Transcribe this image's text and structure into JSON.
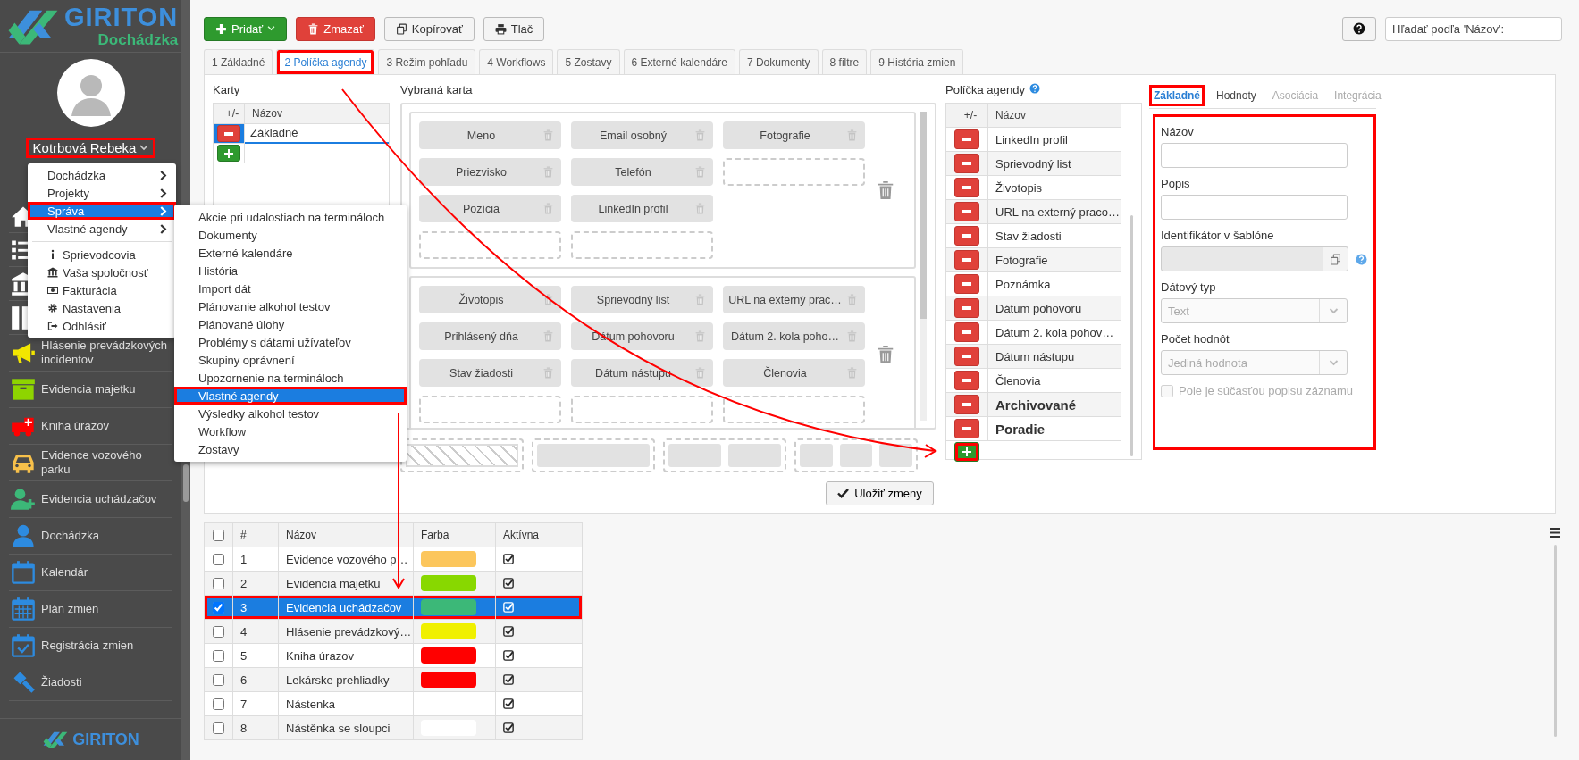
{
  "sidebar": {
    "logo": {
      "title": "GIRITON",
      "subtitle": "Dochádzka"
    },
    "user": {
      "name": "Kotrbová Rebeka",
      "annotated": true
    },
    "nav": [
      {
        "kind": "covered"
      },
      {
        "kind": "covered"
      },
      {
        "kind": "covered"
      },
      {
        "kind": "covered"
      },
      {
        "kind": "link",
        "label": "Hlásenie prevádzkových incidentov"
      },
      {
        "kind": "link",
        "label": "Evidencia majetku"
      },
      {
        "kind": "link",
        "label": "Kniha úrazov"
      },
      {
        "kind": "link",
        "label": "Evidence vozového parku"
      },
      {
        "kind": "link",
        "label": "Evidencia uchádzačov"
      },
      {
        "kind": "link",
        "label": "Dochádzka"
      },
      {
        "kind": "link",
        "label": "Kalendár"
      },
      {
        "kind": "link",
        "label": "Plán zmien"
      },
      {
        "kind": "link",
        "label": "Registrácia zmien"
      },
      {
        "kind": "link",
        "label": "Žiadosti"
      }
    ],
    "footer_logo": "GIRITON"
  },
  "user_menu": {
    "items": [
      {
        "kind": "submenu",
        "label": "Dochádzka",
        "selected": false,
        "annotated": false
      },
      {
        "kind": "submenu",
        "label": "Projekty",
        "selected": false,
        "annotated": false
      },
      {
        "kind": "submenu",
        "label": "Správa",
        "selected": true,
        "annotated": true
      },
      {
        "kind": "submenu",
        "label": "Vlastné agendy",
        "selected": false,
        "annotated": false
      },
      {
        "kind": "action",
        "label": "Sprievodcovia"
      },
      {
        "kind": "action",
        "label": "Vaša spoločnosť"
      },
      {
        "kind": "action",
        "label": "Fakturácia"
      },
      {
        "kind": "action",
        "label": "Nastavenia"
      },
      {
        "kind": "action",
        "label": "Odhlásiť"
      }
    ]
  },
  "submenu": {
    "items": [
      {
        "label": "Akcie pri udalostiach na termináloch",
        "selected": false,
        "annotated": false
      },
      {
        "label": "Dokumenty",
        "selected": false,
        "annotated": false
      },
      {
        "label": "Externé kalendáre",
        "selected": false,
        "annotated": false
      },
      {
        "label": "História",
        "selected": false,
        "annotated": false
      },
      {
        "label": "Import dát",
        "selected": false,
        "annotated": false
      },
      {
        "label": "Plánovanie alkohol testov",
        "selected": false,
        "annotated": false
      },
      {
        "label": "Plánované úlohy",
        "selected": false,
        "annotated": false
      },
      {
        "label": "Problémy s dátami užívateľov",
        "selected": false,
        "annotated": false
      },
      {
        "label": "Skupiny oprávnení",
        "selected": false,
        "annotated": false
      },
      {
        "label": "Upozornenie na termináloch",
        "selected": false,
        "annotated": false
      },
      {
        "label": "Vlastné agendy",
        "selected": true,
        "annotated": true
      },
      {
        "label": "Výsledky alkohol testov",
        "selected": false,
        "annotated": false
      },
      {
        "label": "Workflow",
        "selected": false,
        "annotated": false
      },
      {
        "label": "Zostavy",
        "selected": false,
        "annotated": false
      }
    ]
  },
  "toolbar": {
    "buttons": [
      {
        "kind": "add",
        "label": "Pridať"
      },
      {
        "kind": "delete",
        "label": "Zmazať"
      },
      {
        "kind": "copy",
        "label": "Kopírovať"
      },
      {
        "kind": "print",
        "label": "Tlač"
      }
    ],
    "search": {
      "placeholder": "Hľadať podľa 'Názov':"
    }
  },
  "tabs": [
    {
      "label": "1 Základné",
      "selected": false,
      "annotated": false
    },
    {
      "label": "2 Políčka agendy",
      "selected": true,
      "annotated": true
    },
    {
      "label": "3 Režim pohľadu",
      "selected": false,
      "annotated": false
    },
    {
      "label": "4 Workflows",
      "selected": false,
      "annotated": false
    },
    {
      "label": "5 Zostavy",
      "selected": false,
      "annotated": false
    },
    {
      "label": "6 Externé kalendáre",
      "selected": false,
      "annotated": false
    },
    {
      "label": "7 Dokumenty",
      "selected": false,
      "annotated": false
    },
    {
      "label": "8 filtre",
      "selected": false,
      "annotated": false
    },
    {
      "label": "9 História zmien",
      "selected": false,
      "annotated": false
    }
  ],
  "cards": {
    "title": "Karty",
    "columns": [
      "+/-",
      "Názov"
    ],
    "rows": [
      {
        "name": "Základné",
        "selected": true
      }
    ]
  },
  "selected_card": {
    "title": "Vybraná karta",
    "groups": [
      {
        "columns": [
          [
            {
              "kind": "field",
              "label": "Meno"
            },
            {
              "kind": "field",
              "label": "Priezvisko"
            },
            {
              "kind": "field",
              "label": "Pozícia"
            },
            {
              "kind": "empty"
            }
          ],
          [
            {
              "kind": "field",
              "label": "Email osobný"
            },
            {
              "kind": "field",
              "label": "Telefón"
            },
            {
              "kind": "field",
              "label": "LinkedIn profil"
            },
            {
              "kind": "empty"
            }
          ],
          [
            {
              "kind": "field",
              "label": "Fotografie"
            },
            {
              "kind": "empty"
            }
          ]
        ]
      },
      {
        "columns": [
          [
            {
              "kind": "field",
              "label": "Životopis"
            },
            {
              "kind": "field",
              "label": "Prihlásený dňa"
            },
            {
              "kind": "field",
              "label": "Stav žiadosti"
            },
            {
              "kind": "empty"
            }
          ],
          [
            {
              "kind": "field",
              "label": "Sprievodný list"
            },
            {
              "kind": "field",
              "label": "Dátum pohovoru"
            },
            {
              "kind": "field",
              "label": "Dátum nástupu"
            },
            {
              "kind": "empty"
            }
          ],
          [
            {
              "kind": "field",
              "label": "URL na externý prac…"
            },
            {
              "kind": "field",
              "label": "Dátum 2. kola poho…"
            },
            {
              "kind": "field",
              "label": "Členovia"
            },
            {
              "kind": "empty"
            }
          ]
        ]
      }
    ],
    "save_button": "Uložiť zmeny"
  },
  "fields": {
    "title": "Políčka agendy",
    "columns": [
      "+/-",
      "Názov"
    ],
    "add_annotated": true,
    "rows": [
      {
        "name": "LinkedIn profil",
        "emphasized": false
      },
      {
        "name": "Sprievodný list",
        "emphasized": false
      },
      {
        "name": "Životopis",
        "emphasized": false
      },
      {
        "name": "URL na externý praco…",
        "emphasized": false
      },
      {
        "name": "Stav žiadosti",
        "emphasized": false
      },
      {
        "name": "Fotografie",
        "emphasized": false
      },
      {
        "name": "Poznámka",
        "emphasized": false
      },
      {
        "name": "Dátum pohovoru",
        "emphasized": false
      },
      {
        "name": "Dátum 2. kola pohov…",
        "emphasized": false
      },
      {
        "name": "Dátum nástupu",
        "emphasized": false
      },
      {
        "name": "Členovia",
        "emphasized": false
      },
      {
        "name": "Archivované",
        "emphasized": true
      },
      {
        "name": "Poradie",
        "emphasized": true
      }
    ]
  },
  "detail": {
    "annotated": true,
    "tabs": [
      {
        "label": "Základné",
        "selected": true,
        "disabled": false,
        "annotated": true
      },
      {
        "label": "Hodnoty",
        "selected": false,
        "disabled": false,
        "annotated": false
      },
      {
        "label": "Asociácia",
        "selected": false,
        "disabled": true,
        "annotated": false
      },
      {
        "label": "Integrácia",
        "selected": false,
        "disabled": true,
        "annotated": false
      }
    ],
    "fields": [
      {
        "kind": "text",
        "label": "Názov",
        "disabled": false
      },
      {
        "kind": "text",
        "label": "Popis",
        "disabled": false
      },
      {
        "kind": "copy",
        "label": "Identifikátor v šablóne",
        "disabled": true
      },
      {
        "kind": "select",
        "label": "Dátový typ",
        "value": "Text",
        "disabled": true
      },
      {
        "kind": "select",
        "label": "Počet hodnôt",
        "value": "Jediná hodnota",
        "disabled": true
      },
      {
        "kind": "checkbox",
        "label": "Pole je súčasťou popisu záznamu",
        "checked": false,
        "disabled": true
      }
    ]
  },
  "agendas": {
    "all_selected": false,
    "columns": [
      "#",
      "Názov",
      "Farba",
      "Aktívna"
    ],
    "rows": [
      {
        "number": "1",
        "name": "Evidence vozového p…",
        "color": "#fcc65c",
        "active": true,
        "selected": false,
        "annotated": false
      },
      {
        "number": "2",
        "name": "Evidencia majetku",
        "color": "#88d800",
        "active": true,
        "selected": false,
        "annotated": false
      },
      {
        "number": "3",
        "name": "Evidencia uchádzačov",
        "color": "#3cb878",
        "active": true,
        "selected": true,
        "annotated": true
      },
      {
        "number": "4",
        "name": "Hlásenie prevádzkový…",
        "color": "#f0f000",
        "active": true,
        "selected": false,
        "annotated": false
      },
      {
        "number": "5",
        "name": "Kniha úrazov",
        "color": "#ff0000",
        "active": true,
        "selected": false,
        "annotated": false
      },
      {
        "number": "6",
        "name": "Lekárske prehliadky",
        "color": "#ff0000",
        "active": true,
        "selected": false,
        "annotated": false
      },
      {
        "number": "7",
        "name": "Nástenka",
        "active": true,
        "selected": false,
        "annotated": false
      },
      {
        "number": "8",
        "name": "Nástěnka se sloupci",
        "color": "#ffffff",
        "active": true,
        "selected": false,
        "annotated": false
      }
    ]
  }
}
